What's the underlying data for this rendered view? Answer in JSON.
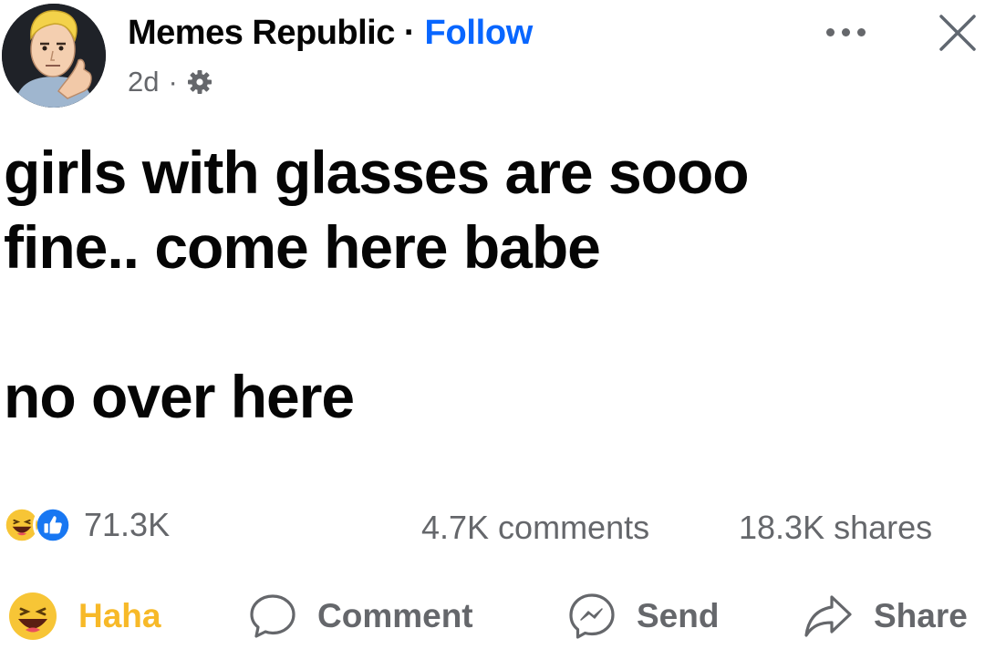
{
  "header": {
    "page_name": "Memes Republic",
    "separator": "·",
    "follow_label": "Follow",
    "time_ago": "2d",
    "meta_separator": "·",
    "privacy_icon": "gear-icon",
    "more_icon": "more-horizontal-icon",
    "close_icon": "close-icon"
  },
  "post": {
    "lines": [
      "girls with glasses are sooo",
      "fine.. come here babe",
      "no over here"
    ]
  },
  "stats": {
    "reaction_icons": [
      "haha-reaction-icon",
      "like-reaction-icon"
    ],
    "reaction_count": "71.3K",
    "comments": "4.7K comments",
    "shares": "18.3K shares"
  },
  "actions": {
    "haha_label": "Haha",
    "comment_label": "Comment",
    "send_label": "Send",
    "share_label": "Share"
  },
  "colors": {
    "follow_blue": "#0866ff",
    "haha_yellow": "#f7b928",
    "secondary_text": "#65676b",
    "primary_text": "#050505"
  }
}
